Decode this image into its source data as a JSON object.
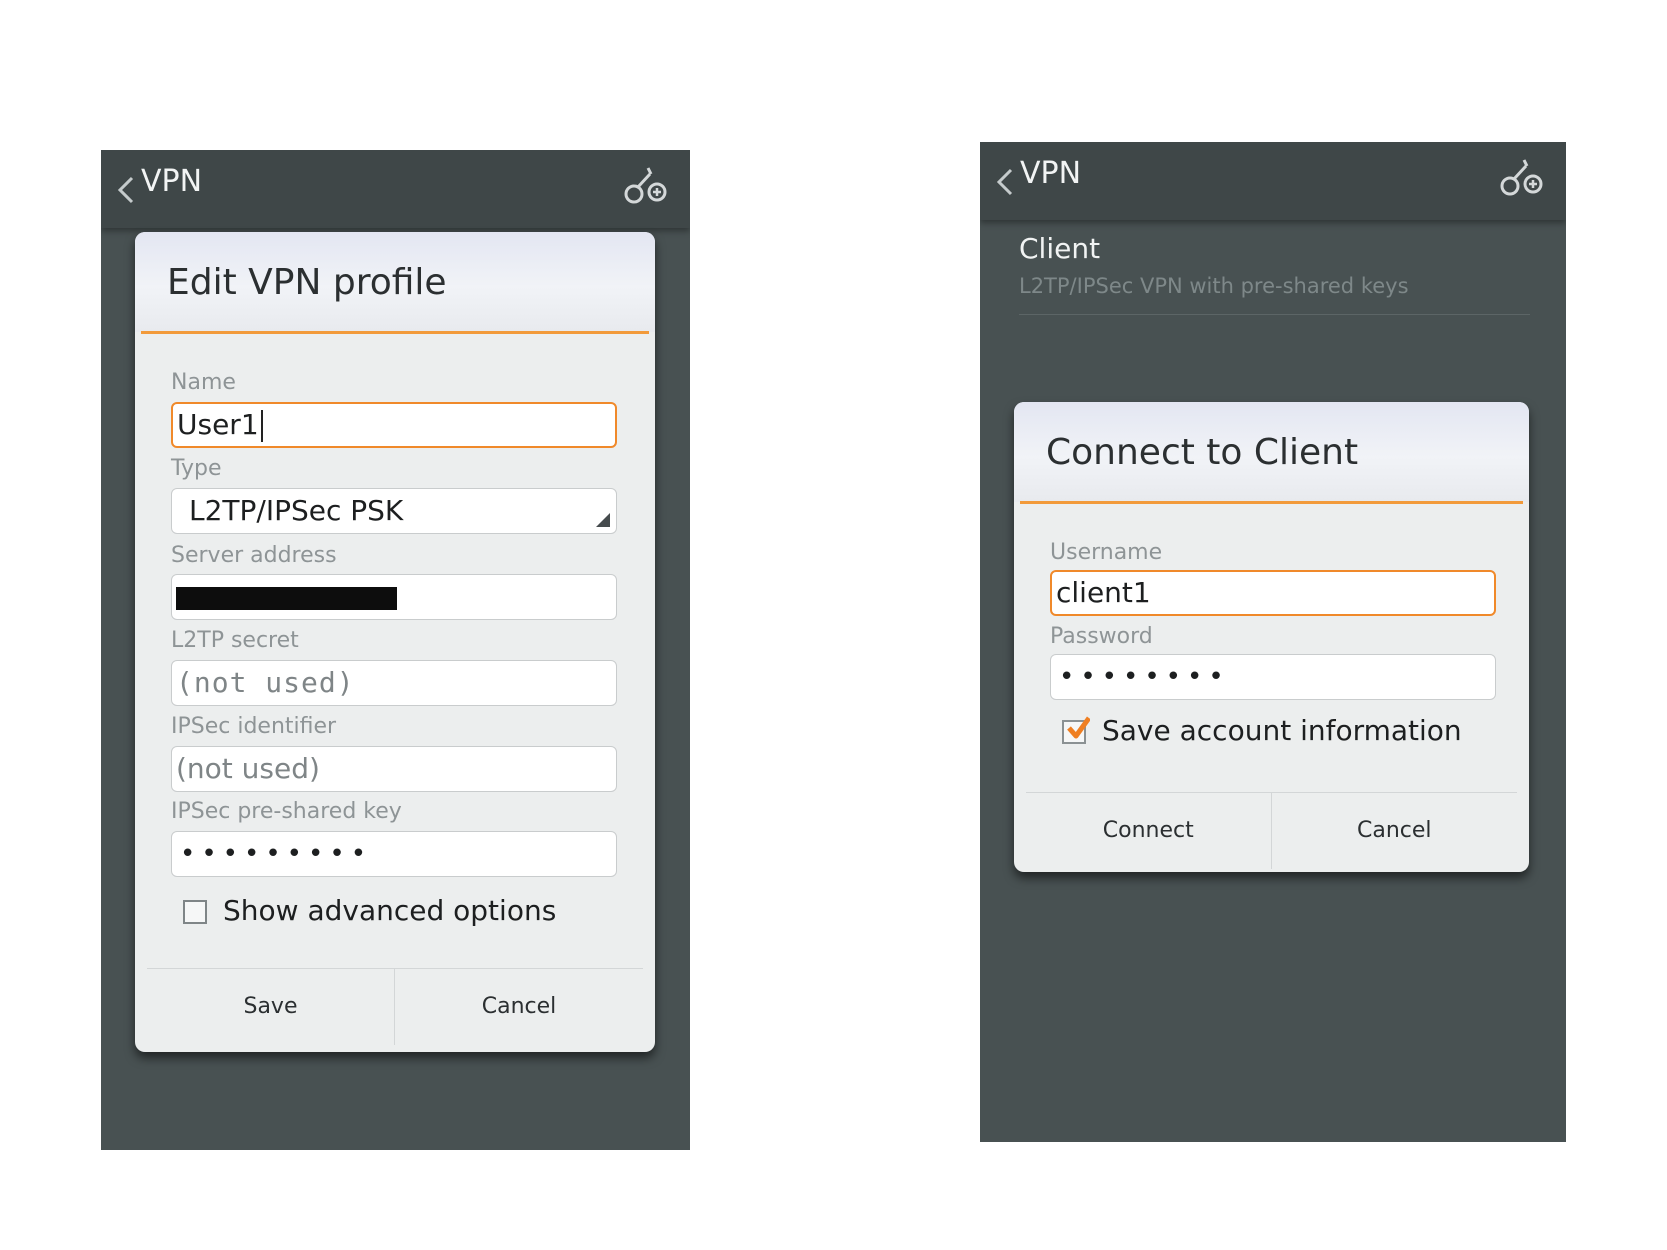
{
  "left_screen": {
    "appbar": {
      "title": "VPN",
      "back_icon": "chevron-left-icon",
      "add_icon": "add-vpn-icon"
    },
    "dialog": {
      "title": "Edit VPN profile",
      "fields": {
        "name": {
          "label": "Name",
          "value": "User1"
        },
        "type": {
          "label": "Type",
          "value": "L2TP/IPSec PSK"
        },
        "server": {
          "label": "Server address",
          "value": ""
        },
        "l2tp_secret": {
          "label": "L2TP secret",
          "placeholder": "(not used)"
        },
        "ipsec_identifier": {
          "label": "IPSec identifier",
          "placeholder": "(not used)"
        },
        "ipsec_psk": {
          "label": "IPSec pre-shared key",
          "value": "•••••••••"
        }
      },
      "advanced_label": "Show advanced options",
      "advanced_checked": false,
      "save_label": "Save",
      "cancel_label": "Cancel"
    }
  },
  "right_screen": {
    "appbar": {
      "title": "VPN",
      "back_icon": "chevron-left-icon",
      "add_icon": "add-vpn-icon"
    },
    "list_item": {
      "title": "Client",
      "subtitle": "L2TP/IPSec VPN with pre-shared keys"
    },
    "dialog": {
      "title": "Connect to Client",
      "fields": {
        "username": {
          "label": "Username",
          "value": "client1"
        },
        "password": {
          "label": "Password",
          "value": "••••••••"
        }
      },
      "save_account_label": "Save account information",
      "save_account_checked": true,
      "connect_label": "Connect",
      "cancel_label": "Cancel"
    }
  },
  "colors": {
    "accent": "#f0892a",
    "screen_bg": "#485152",
    "appbar_bg": "#3f4748",
    "dialog_bg": "#eceeee"
  }
}
